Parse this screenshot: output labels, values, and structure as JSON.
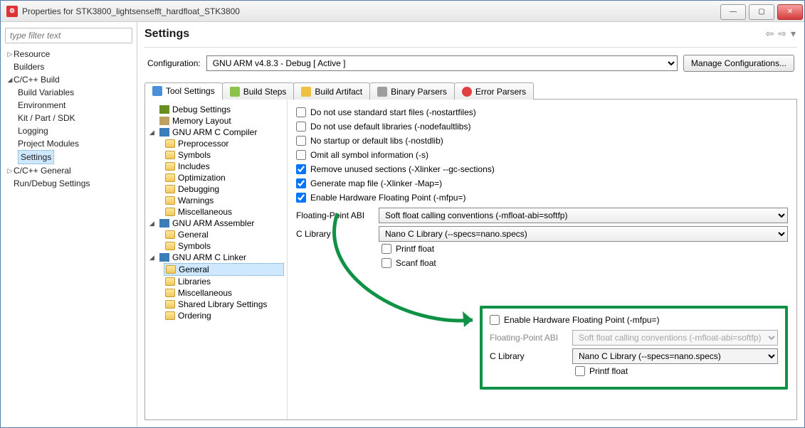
{
  "window": {
    "title": "Properties for STK3800_lightsensefft_hardfloat_STK3800"
  },
  "sidebar": {
    "filterPlaceholder": "type filter text",
    "items": {
      "resource": "Resource",
      "builders": "Builders",
      "cbuild": "C/C++ Build",
      "buildvars": "Build Variables",
      "environment": "Environment",
      "kit": "Kit / Part / SDK",
      "logging": "Logging",
      "projmod": "Project Modules",
      "settings": "Settings",
      "cgeneral": "C/C++ General",
      "rundebug": "Run/Debug Settings"
    }
  },
  "header": {
    "title": "Settings"
  },
  "config": {
    "label": "Configuration:",
    "value": "GNU ARM v4.8.3 - Debug  [ Active ]",
    "manage": "Manage Configurations..."
  },
  "tabs": {
    "toolsettings": "Tool Settings",
    "buildsteps": "Build Steps",
    "buildartifact": "Build Artifact",
    "binaryparsers": "Binary Parsers",
    "errorparsers": "Error Parsers"
  },
  "tooltree": {
    "debug": "Debug Settings",
    "memory": "Memory Layout",
    "ccompiler": "GNU ARM C Compiler",
    "preproc": "Preprocessor",
    "symbols": "Symbols",
    "includes": "Includes",
    "optimization": "Optimization",
    "debugging": "Debugging",
    "warnings": "Warnings",
    "misc": "Miscellaneous",
    "assembler": "GNU ARM Assembler",
    "asm_general": "General",
    "asm_symbols": "Symbols",
    "linker": "GNU ARM C Linker",
    "lnk_general": "General",
    "lnk_libraries": "Libraries",
    "lnk_misc": "Miscellaneous",
    "lnk_shared": "Shared Library Settings",
    "lnk_ordering": "Ordering"
  },
  "settings": {
    "nostart": "Do not use standard start files (-nostartfiles)",
    "nodeflibs": "Do not use default libraries (-nodefaultlibs)",
    "nostdlib": "No startup or default libs (-nostdlib)",
    "omitsym": "Omit all symbol information (-s)",
    "gcsections": "Remove unused sections (-Xlinker --gc-sections)",
    "mapfile": "Generate map file (-Xlinker -Map=)",
    "hwfp": "Enable Hardware Floating Point (-mfpu=)",
    "fpabiLabel": "Floating-Point ABI",
    "fpabiValue": "Soft float calling conventions (-mfloat-abi=softfp)",
    "clibLabel": "C Library",
    "clibValue": "Nano C Library (--specs=nano.specs)",
    "printf": "Printf float",
    "scanf": "Scanf float"
  },
  "highlight": {
    "hwfp": "Enable Hardware Floating Point (-mfpu=)",
    "fpabiLabel": "Floating-Point ABI",
    "fpabiValue": "Soft float calling conventions (-mfloat-abi=softfp)",
    "clibLabel": "C Library",
    "clibValue": "Nano C Library (--specs=nano.specs)",
    "printf": "Printf float"
  }
}
